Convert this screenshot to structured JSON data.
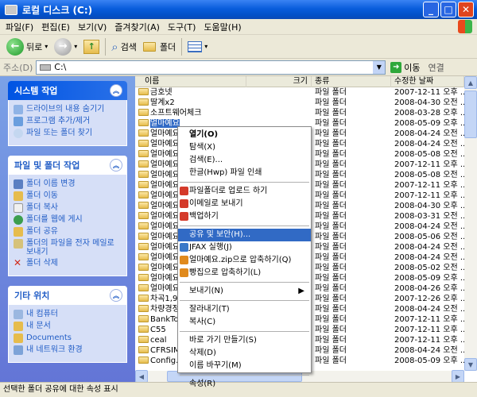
{
  "window": {
    "title": "로컬 디스크 (C:)",
    "buttons": [
      "_",
      "□",
      "✕"
    ]
  },
  "menu": [
    "파일(F)",
    "편집(E)",
    "보기(V)",
    "즐겨찾기(A)",
    "도구(T)",
    "도움말(H)"
  ],
  "toolbar": {
    "back": "뒤로",
    "search": "검색",
    "folders": "폴더"
  },
  "address": {
    "label": "주소(D)",
    "value": "C:\\",
    "go": "이동",
    "links": "연결"
  },
  "panels": [
    {
      "title": "시스템 작업",
      "tasks": [
        "드라이브의 내용 숨기기",
        "프로그램 추가/제거",
        "파일 또는 폴더 찾기"
      ]
    },
    {
      "title": "파일 및 폴더 작업",
      "tasks": [
        "폴더 이름 변경",
        "폴더 이동",
        "폴더 복사",
        "폴더를 웹에 게시",
        "폴더 공유",
        "폴더의 파일을 전자 메일로 보내기",
        "폴더 삭제"
      ]
    },
    {
      "title": "기타 위치",
      "tasks": [
        "내 컴퓨터",
        "내 문서",
        "Documents",
        "내 네트워크 환경"
      ]
    }
  ],
  "columns": [
    "이름",
    "크기",
    "종류",
    "수정한 날짜"
  ],
  "files": [
    {
      "name": "금호넷",
      "type": "파일 폴더",
      "date": "2007-12-11 오후 ..."
    },
    {
      "name": "딸계x2",
      "type": "파일 폴더",
      "date": "2008-04-30 오전 ..."
    },
    {
      "name": "소프트웨어체크",
      "type": "파일 폴더",
      "date": "2008-03-28 오후 ..."
    },
    {
      "name": "얼마예요",
      "type": "파일 폴더",
      "date": "2008-05-09 오후 ..."
    },
    {
      "name": "얼마예요",
      "type": "파일 폴더",
      "date": "2008-04-24 오전 ..."
    },
    {
      "name": "얼마예요",
      "type": "파일 폴더",
      "date": "2008-04-24 오전 ..."
    },
    {
      "name": "얼마예요",
      "type": "파일 폴더",
      "date": "2008-05-08 오전 ..."
    },
    {
      "name": "얼마예요",
      "type": "파일 폴더",
      "date": "2007-12-11 오후 ..."
    },
    {
      "name": "얼마예요",
      "type": "파일 폴더",
      "date": "2008-05-08 오전 ..."
    },
    {
      "name": "얼마예요",
      "type": "파일 폴더",
      "date": "2007-12-11 오후 ..."
    },
    {
      "name": "얼마예요",
      "type": "파일 폴더",
      "date": "2007-12-11 오후 ..."
    },
    {
      "name": "얼마예요",
      "type": "파일 폴더",
      "date": "2008-04-30 오후 ..."
    },
    {
      "name": "얼마예요",
      "type": "파일 폴더",
      "date": "2008-03-31 오전 ..."
    },
    {
      "name": "얼마예요",
      "type": "파일 폴더",
      "date": "2008-04-24 오전 ..."
    },
    {
      "name": "얼마예요",
      "type": "파일 폴더",
      "date": "2008-05-06 오전 ..."
    },
    {
      "name": "얼마예요",
      "type": "파일 폴더",
      "date": "2008-04-24 오전 ..."
    },
    {
      "name": "얼마예요",
      "type": "파일 폴더",
      "date": "2008-04-24 오전 ..."
    },
    {
      "name": "얼마예요",
      "type": "파일 폴더",
      "date": "2008-05-02 오전 ..."
    },
    {
      "name": "얼마예요",
      "type": "파일 폴더",
      "date": "2008-05-09 오후 ..."
    },
    {
      "name": "얼마예요",
      "type": "파일 폴더",
      "date": "2008-04-26 오후 ..."
    },
    {
      "name": "차곡1,9",
      "type": "파일 폴더",
      "date": "2007-12-26 오후 ..."
    },
    {
      "name": "차량경정",
      "type": "파일 폴더",
      "date": "2008-04-24 오전 ..."
    },
    {
      "name": "BankTo",
      "type": "파일 폴더",
      "date": "2007-12-11 오후 ..."
    },
    {
      "name": "C55",
      "type": "파일 폴더",
      "date": "2007-12-11 오후 ..."
    },
    {
      "name": "ceal",
      "type": "파일 폴더",
      "date": "2007-12-11 오후 ..."
    },
    {
      "name": "CFRSIM",
      "type": "파일 폴더",
      "date": "2008-04-24 오전 ..."
    },
    {
      "name": "Config.Msi",
      "type": "파일 폴더",
      "date": "2008-05-09 오후 ..."
    }
  ],
  "context_menu": {
    "items": [
      {
        "label": "열기(O)",
        "bold": true
      },
      {
        "label": "탐색(X)"
      },
      {
        "label": "검색(E)..."
      },
      {
        "label": "한글(Hwp) 파일 인쇄"
      },
      {
        "sep": true
      },
      {
        "label": "파일폴더로 업로드 하기",
        "icon": "#d43a2a"
      },
      {
        "label": "이메일로 보내기",
        "icon": "#d43a2a"
      },
      {
        "label": "백업하기",
        "icon": "#d43a2a"
      },
      {
        "sep": true
      },
      {
        "label": "공유 및 보안(H)...",
        "hl": true
      },
      {
        "label": "JFAX 실행(J)",
        "icon": "#3a78c8"
      },
      {
        "label": "얼마예요.zip으로 압축하기(Q)",
        "icon": "#e08a1d"
      },
      {
        "label": "빵집으로 압축하기(L)",
        "icon": "#e08a1d"
      },
      {
        "sep": true
      },
      {
        "label": "보내기(N)",
        "arrow": "▶"
      },
      {
        "sep": true
      },
      {
        "label": "잘라내기(T)"
      },
      {
        "label": "복사(C)"
      },
      {
        "sep": true
      },
      {
        "label": "바로 가기 만들기(S)"
      },
      {
        "label": "삭제(D)"
      },
      {
        "label": "이름 바꾸기(M)"
      },
      {
        "sep": true
      },
      {
        "label": "속성(R)"
      }
    ]
  },
  "status": "선택한 폴더 공유에 대한 속성 표시"
}
